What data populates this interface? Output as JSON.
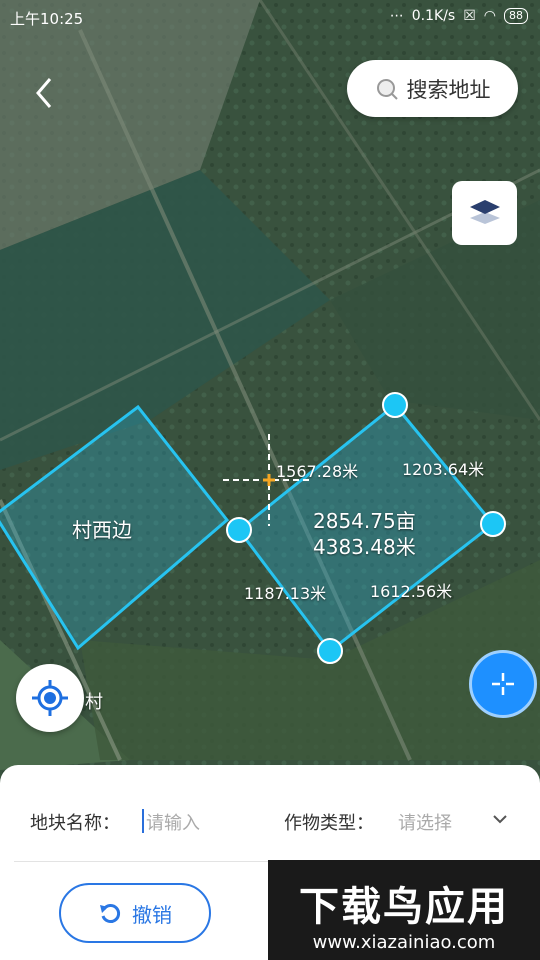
{
  "status": {
    "time": "上午10:25",
    "speed": "0.1K/s",
    "battery": "88"
  },
  "search": {
    "label": "搜索地址"
  },
  "map_labels": {
    "plot_name": "村西边",
    "village_fragment": "村",
    "area": "2854.75亩",
    "perimeter": "4383.48米",
    "edges": [
      "1567.28米",
      "1203.64米",
      "1187.13米",
      "1612.56米"
    ]
  },
  "form": {
    "name_label": "地块名称：",
    "name_placeholder": "请输入",
    "crop_label": "作物类型：",
    "crop_placeholder": "请选择"
  },
  "actions": {
    "undo_label": "撤销"
  },
  "watermark": {
    "title": "下载鸟应用",
    "url": "www.xiazainiao.com"
  },
  "colors": {
    "accent": "#2a77e4",
    "polygon_stroke": "#27c3f0",
    "vertex": "#1cc6f5"
  }
}
